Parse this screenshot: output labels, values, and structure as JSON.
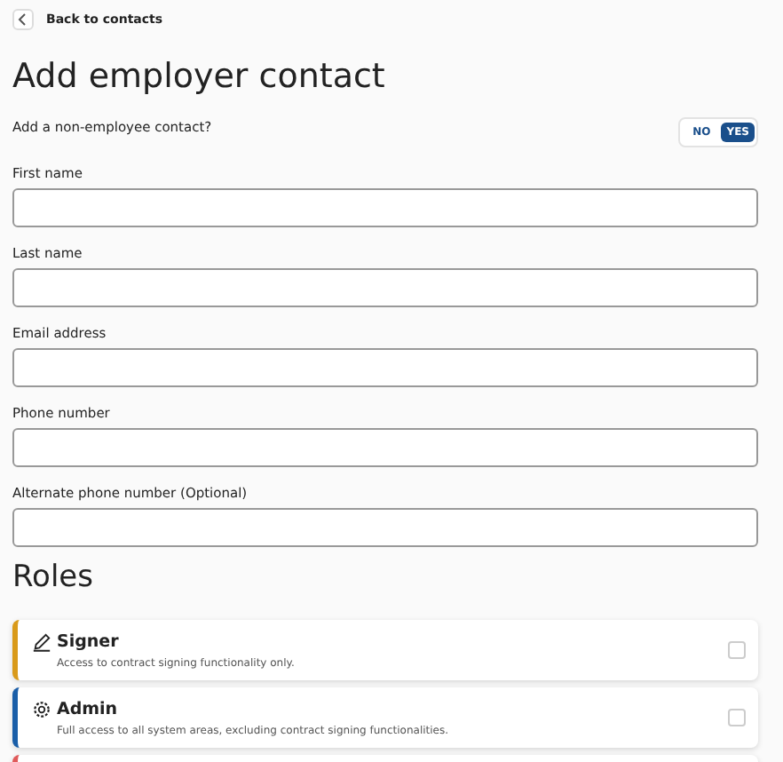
{
  "back_link": {
    "label": "Back to contacts"
  },
  "title": "Add employer contact",
  "non_employee": {
    "label": "Add a non-employee contact?",
    "options": [
      {
        "label": "NO",
        "selected": false
      },
      {
        "label": "YES",
        "selected": true
      }
    ]
  },
  "fields": [
    {
      "label": "First name"
    },
    {
      "label": "Last name"
    },
    {
      "label": "Email address"
    },
    {
      "label": "Phone number"
    },
    {
      "label": "Alternate phone number (Optional)"
    }
  ],
  "roles_heading": "Roles",
  "roles": [
    {
      "kind": "pen",
      "title": "Signer",
      "description": "Access to contract signing functionality only.",
      "color": "#d99a1a",
      "checked": false
    },
    {
      "kind": "gear",
      "title": "Admin",
      "description": "Full access to all system areas, excluding contract signing functionalities.",
      "color": "#1a5ea8",
      "checked": false
    },
    {
      "color": "#e05a5a"
    }
  ]
}
